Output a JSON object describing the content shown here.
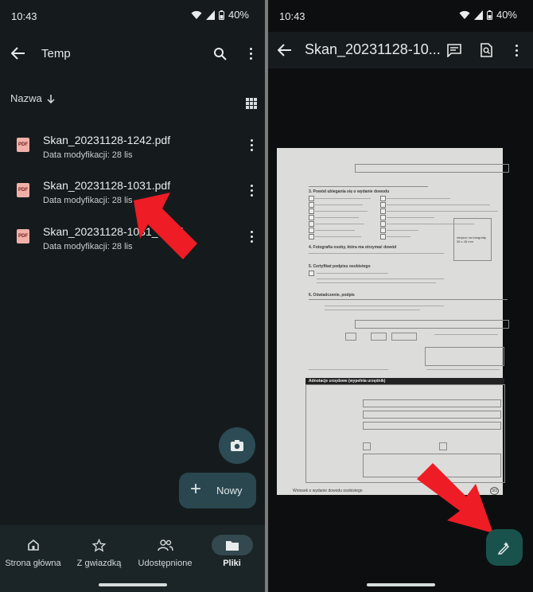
{
  "left": {
    "status": {
      "time": "10:43",
      "battery": "40%"
    },
    "appbar": {
      "title": "Temp"
    },
    "sort": {
      "label": "Nazwa"
    },
    "files": [
      {
        "name": "Skan_20231128-1242.pdf",
        "meta": "Data modyfikacji: 28 lis",
        "type": "PDF"
      },
      {
        "name": "Skan_20231128-1031.pdf",
        "meta": "Data modyfikacji: 28 lis",
        "type": "PDF"
      },
      {
        "name": "Skan_20231128-1031_1.pdf",
        "meta": "Data modyfikacji: 28 lis",
        "type": "PDF"
      }
    ],
    "fab_new": {
      "label": "Nowy"
    },
    "nav": [
      {
        "label": "Strona główna",
        "icon": "home-icon"
      },
      {
        "label": "Z gwiazdką",
        "icon": "star-icon"
      },
      {
        "label": "Udostępnione",
        "icon": "people-icon"
      },
      {
        "label": "Pliki",
        "icon": "folder-icon",
        "active": true
      }
    ]
  },
  "right": {
    "status": {
      "time": "10:43",
      "battery": "40%"
    },
    "appbar": {
      "title": "Skan_20231128-10..."
    },
    "document": {
      "s3": "3. Powód ubiegania się o wydanie dowodu",
      "s4": "4. Fotografia osoby, która ma otrzymać dowód",
      "s5": "5. Certyfikat podpisu osobistego",
      "s6": "6. Oświadczenie, podpis",
      "photo_box": "miejsce na fotografię 35 x 45 mm",
      "admin_header": "Adnotacje urzędowe (wypełnia urzędnik)",
      "footer": "Wniosek o wydanie dowodu osobistego",
      "page": "3/3"
    }
  },
  "colors": {
    "accent_arrow": "#ee1c25",
    "fab_edit": "#19524c",
    "fab_new": "#2a4750"
  }
}
